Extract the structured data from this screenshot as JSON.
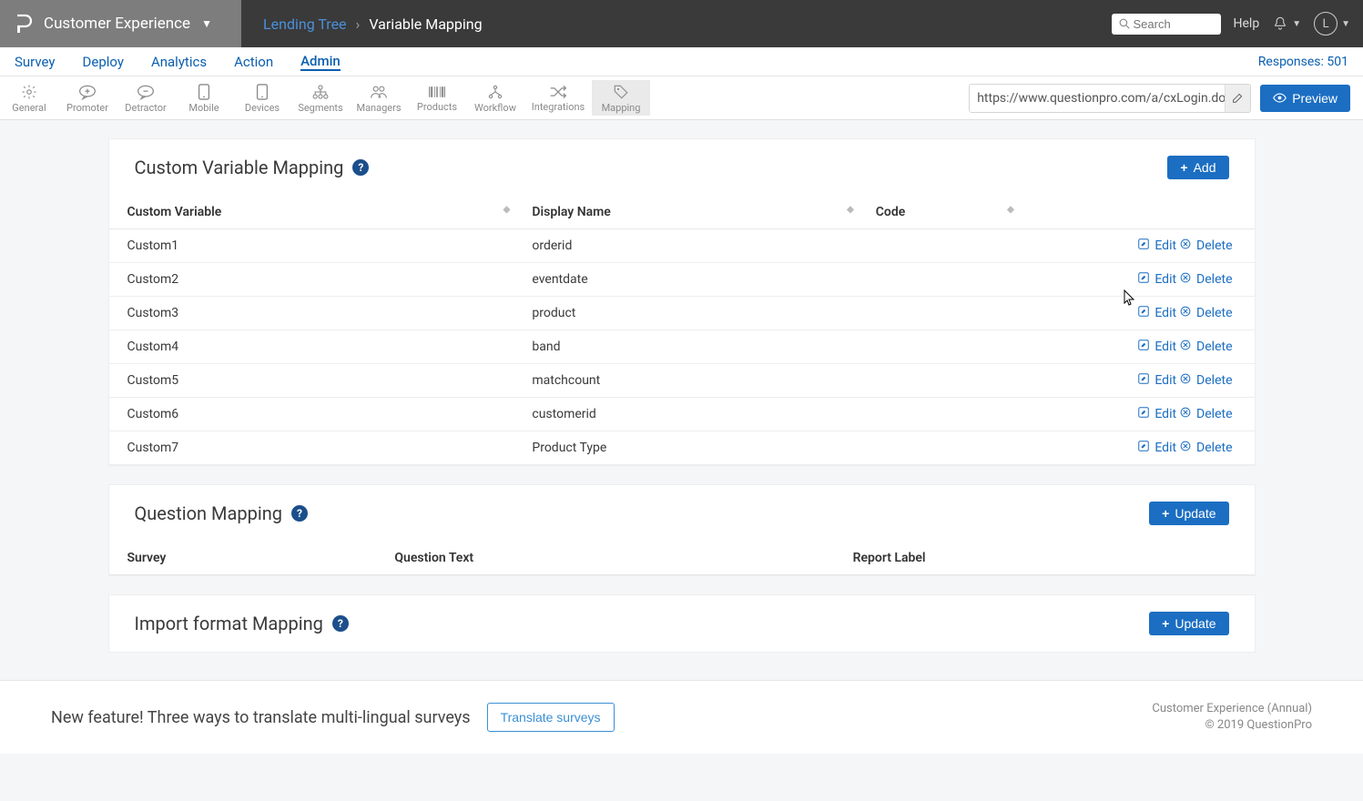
{
  "brand": {
    "name": "Customer Experience"
  },
  "breadcrumb": {
    "project": "Lending Tree",
    "page": "Variable Mapping"
  },
  "top": {
    "search_placeholder": "Search",
    "help": "Help",
    "avatar_letter": "L"
  },
  "nav": {
    "tabs": [
      "Survey",
      "Deploy",
      "Analytics",
      "Action",
      "Admin"
    ],
    "active": "Admin",
    "responses_label": "Responses: 501"
  },
  "toolbar": {
    "items": [
      {
        "label": "General",
        "icon": "gear"
      },
      {
        "label": "Promoter",
        "icon": "plus-bubble"
      },
      {
        "label": "Detractor",
        "icon": "bubble"
      },
      {
        "label": "Mobile",
        "icon": "phone"
      },
      {
        "label": "Devices",
        "icon": "phone"
      },
      {
        "label": "Segments",
        "icon": "hierarchy"
      },
      {
        "label": "Managers",
        "icon": "people"
      },
      {
        "label": "Products",
        "icon": "barcode"
      },
      {
        "label": "Workflow",
        "icon": "flow"
      },
      {
        "label": "Integrations",
        "icon": "shuffle"
      },
      {
        "label": "Mapping",
        "icon": "tag"
      }
    ],
    "active": "Mapping",
    "url": "https://www.questionpro.com/a/cxLogin.do?",
    "preview": "Preview"
  },
  "panels": {
    "custom_mapping": {
      "title": "Custom Variable Mapping",
      "add_label": "Add",
      "columns": [
        "Custom Variable",
        "Display Name",
        "Code"
      ],
      "rows": [
        {
          "var": "Custom1",
          "name": "orderid",
          "code": ""
        },
        {
          "var": "Custom2",
          "name": "eventdate",
          "code": ""
        },
        {
          "var": "Custom3",
          "name": "product",
          "code": ""
        },
        {
          "var": "Custom4",
          "name": "band",
          "code": ""
        },
        {
          "var": "Custom5",
          "name": "matchcount",
          "code": ""
        },
        {
          "var": "Custom6",
          "name": "customerid",
          "code": ""
        },
        {
          "var": "Custom7",
          "name": "Product Type",
          "code": ""
        }
      ],
      "edit": "Edit",
      "delete": "Delete"
    },
    "question_mapping": {
      "title": "Question Mapping",
      "update_label": "Update",
      "columns": [
        "Survey",
        "Question Text",
        "Report Label"
      ]
    },
    "import_mapping": {
      "title": "Import format Mapping",
      "update_label": "Update"
    }
  },
  "footer": {
    "message": "New feature! Three ways to translate multi-lingual surveys",
    "button": "Translate surveys",
    "right1": "Customer Experience (Annual)",
    "right2": "© 2019 QuestionPro"
  }
}
